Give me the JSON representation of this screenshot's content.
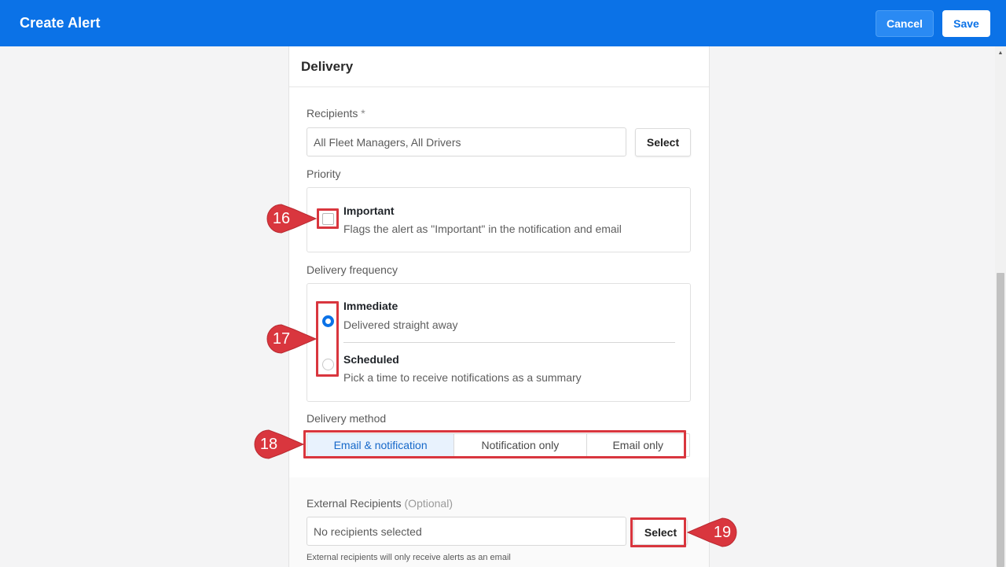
{
  "header": {
    "title": "Create Alert",
    "cancel_label": "Cancel",
    "save_label": "Save"
  },
  "section": {
    "title": "Delivery"
  },
  "recipients": {
    "label": "Recipients",
    "required_mark": "*",
    "value": "All Fleet Managers, All Drivers",
    "select_label": "Select"
  },
  "priority": {
    "label": "Priority",
    "option_title": "Important",
    "option_desc": "Flags the alert as \"Important\" in the notification and email",
    "checked": false
  },
  "frequency": {
    "label": "Delivery frequency",
    "options": [
      {
        "title": "Immediate",
        "desc": "Delivered straight away",
        "selected": true
      },
      {
        "title": "Scheduled",
        "desc": "Pick a time to receive notifications as a summary",
        "selected": false
      }
    ]
  },
  "method": {
    "label": "Delivery method",
    "options": [
      "Email & notification",
      "Notification only",
      "Email only"
    ],
    "selected": "Email & notification"
  },
  "external": {
    "label": "External Recipients",
    "optional": "(Optional)",
    "placeholder": "No recipients selected",
    "select_label": "Select",
    "help": "External recipients will only receive alerts as an email"
  },
  "callouts": [
    "16",
    "17",
    "18",
    "19"
  ],
  "colors": {
    "brand_blue": "#0b72e7",
    "callout_red": "#d9363e",
    "selected_segment_bg": "#e8f2fd"
  }
}
